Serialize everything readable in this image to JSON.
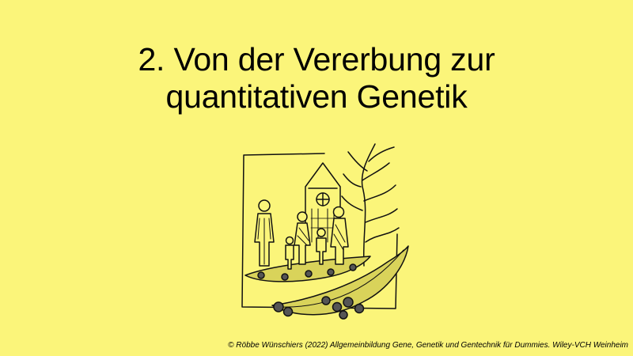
{
  "slide": {
    "title_line1": "2. Von der Vererbung zur",
    "title_line2": "quantitativen Genetik",
    "credit": "© Röbbe Wünschiers (2022) Allgemeinbildung Gene, Genetik und Gentechnik für Dummies. Wiley-VCH Weinheim"
  },
  "illustration": {
    "icon": "family-in-pea-pod-illustration",
    "colors": {
      "background": "#fbf57a",
      "ink": "#111111",
      "accent": "#d9d35a"
    }
  }
}
